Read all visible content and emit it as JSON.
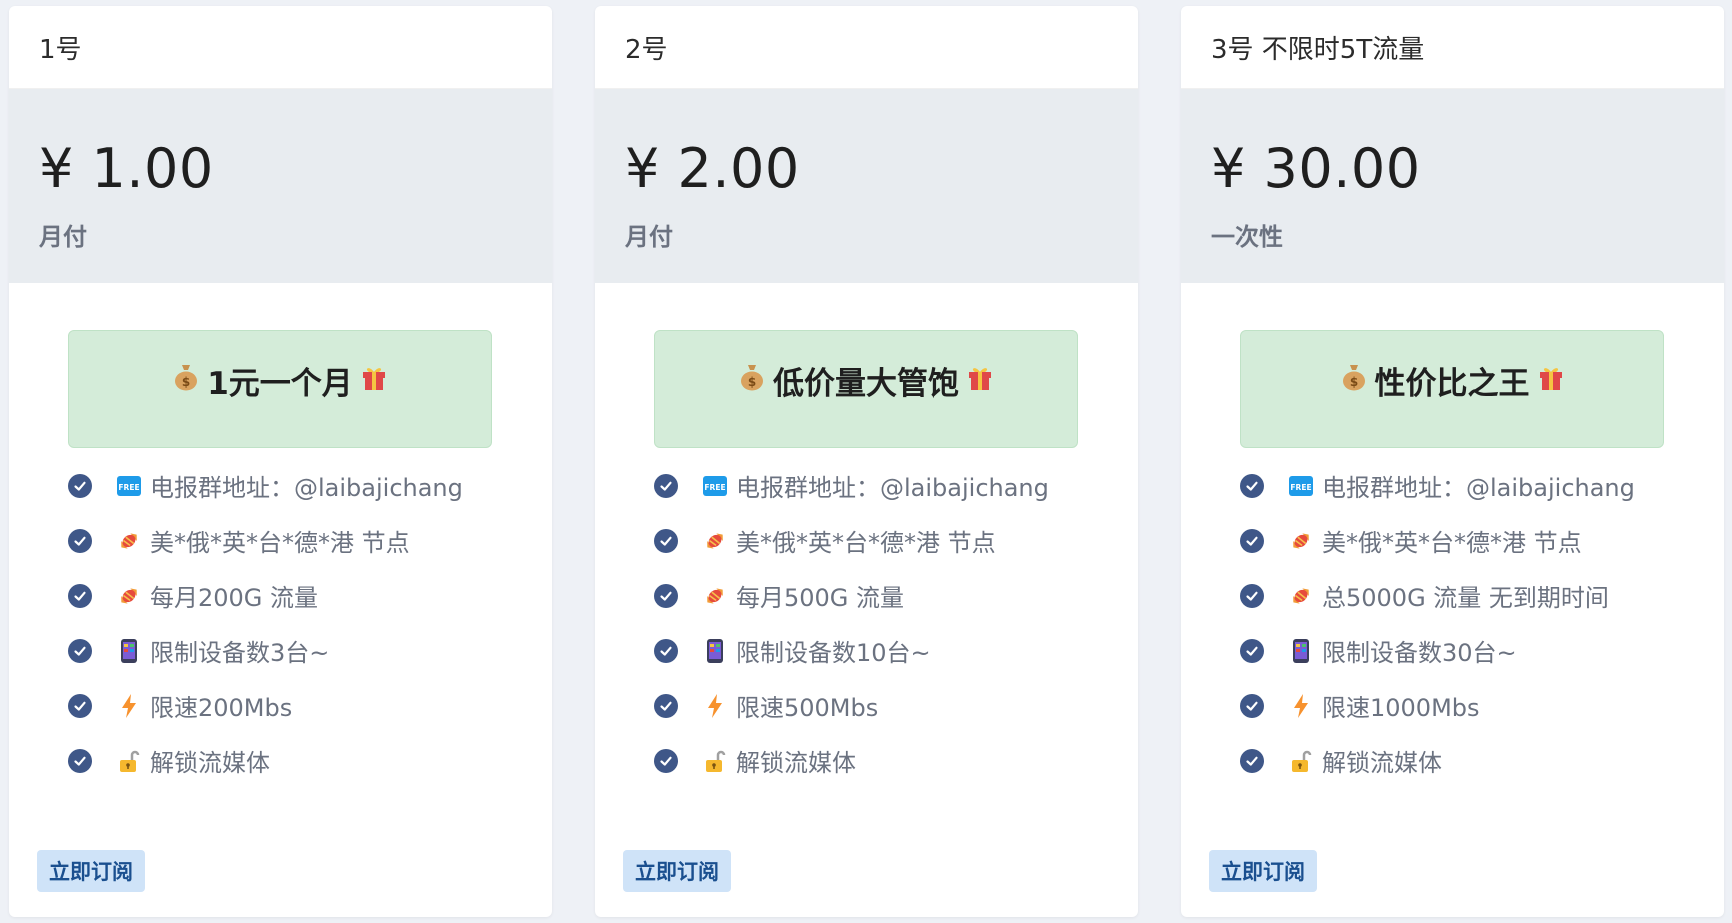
{
  "plans": [
    {
      "name": "1号",
      "price": "¥ 1.00",
      "period": "月付",
      "promo": "1元一个月",
      "features": [
        "电报群地址：@laibajichang",
        "美*俄*英*台*德*港 节点",
        "每月200G 流量",
        "限制设备数3台~",
        "限速200Mbs",
        "解锁流媒体"
      ],
      "button": "立即订阅"
    },
    {
      "name": "2号",
      "price": "¥ 2.00",
      "period": "月付",
      "promo": "低价量大管饱",
      "features": [
        "电报群地址：@laibajichang",
        "美*俄*英*台*德*港 节点",
        "每月500G 流量",
        "限制设备数10台~",
        "限速500Mbs",
        "解锁流媒体"
      ],
      "button": "立即订阅"
    },
    {
      "name": "3号 不限时5T流量",
      "price": "¥ 30.00",
      "period": "一次性",
      "promo": "性价比之王",
      "features": [
        "电报群地址：@laibajichang",
        "美*俄*英*台*德*港 节点",
        "总5000G 流量 无到期时间",
        "限制设备数30台~",
        "限速1000Mbs",
        "解锁流媒体"
      ],
      "button": "立即订阅"
    }
  ],
  "feature_icons": [
    "free-icon",
    "candy-icon",
    "candy-icon",
    "phone-icon",
    "lightning-icon",
    "unlock-icon"
  ],
  "colors": {
    "page_bg": "#eef1f6",
    "price_bg": "#e8ecf0",
    "promo_bg": "#d4ecd9",
    "check": "#3f5788",
    "button_bg": "#cfe3f8",
    "button_text": "#1a4f8f"
  }
}
